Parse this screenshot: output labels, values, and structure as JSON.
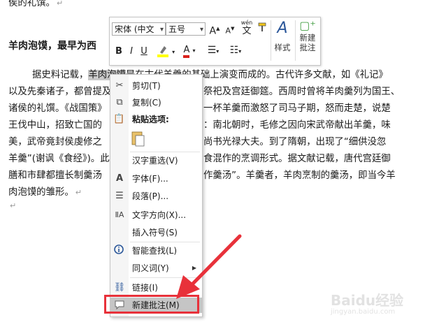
{
  "document": {
    "lines": [
      {
        "text": "侯的礼馔。",
        "mark": "↵"
      },
      {
        "text": "羊肉泡馍，最早为西",
        "mark": ""
      },
      {
        "text_a": "据史料记载，",
        "text_sel": "羊肉泡馍",
        "text_b": "是在古代羊羹的基础上演变而成的。古代许多文献，如《礼记》",
        "mark": ""
      },
      {
        "text": "以及先秦诸子，都曾提及",
        "text_tail": "祭祀及宫廷御筵。西周时曾将羊肉羹列为国王、"
      },
      {
        "text": "诸侯的礼馔。《战国策》",
        "text_tail": "一杯羊羹而激怒了司马子期，怒而走楚，说楚"
      },
      {
        "text": "王伐中山，招致亡国的",
        "text_tail": "：南北朝时，毛修之因向宋武帝献出羊羹，味"
      },
      {
        "text": "美，武帝竟封侯虔修之",
        "text_tail": "尚书光禄大夫。到了隋朝，出现了“细供没忽"
      },
      {
        "text": "羊羹”(谢讽《食经》)。此",
        "text_tail": "食混作的烹调形式。据文献记载，唐代宫廷御"
      },
      {
        "text": "膳和市肆都擅长制羹汤",
        "text_tail": "作羹汤”。羊羹者，羊肉烹制的羹汤，即当今羊"
      },
      {
        "text": "肉泡馍的雏形。",
        "mark": "↵"
      },
      {
        "text": "",
        "mark": "↵"
      }
    ]
  },
  "mini_toolbar": {
    "font_name": "宋体 (中文",
    "font_size": "五号",
    "grow_font": "A",
    "shrink_font": "A",
    "phonetic": "wén",
    "bold": "B",
    "italic": "I",
    "underline": "U",
    "font_color": "A",
    "styles_label": "样式",
    "new_comment_label_1": "新建",
    "new_comment_label_2": "批注"
  },
  "context_menu": {
    "items": [
      {
        "label": "剪切(T)",
        "icon": "scissors-icon"
      },
      {
        "label": "复制(C)",
        "icon": "copy-icon"
      },
      {
        "label": "粘贴选项:",
        "icon": "paste-icon"
      },
      {
        "label": "汉字重选(V)",
        "icon": ""
      },
      {
        "label": "字体(F)...",
        "icon": "font-icon"
      },
      {
        "label": "段落(P)...",
        "icon": "paragraph-icon"
      },
      {
        "label": "文字方向(X)...",
        "icon": "text-direction-icon"
      },
      {
        "label": "插入符号(S)",
        "icon": ""
      },
      {
        "label": "智能查找(L)",
        "icon": "smart-lookup-icon"
      },
      {
        "label": "同义词(Y)",
        "icon": ""
      },
      {
        "label": "链接(I)",
        "icon": "link-icon"
      },
      {
        "label": "新建批注(M)",
        "icon": "comment-icon"
      }
    ]
  },
  "watermark": {
    "text": "Baidu经验",
    "sub": "jingyan.baidu.com"
  },
  "colors": {
    "arrow": "#e8313a",
    "highlight_border": "#e8313a",
    "menu_hover": "#c5c5c5"
  }
}
